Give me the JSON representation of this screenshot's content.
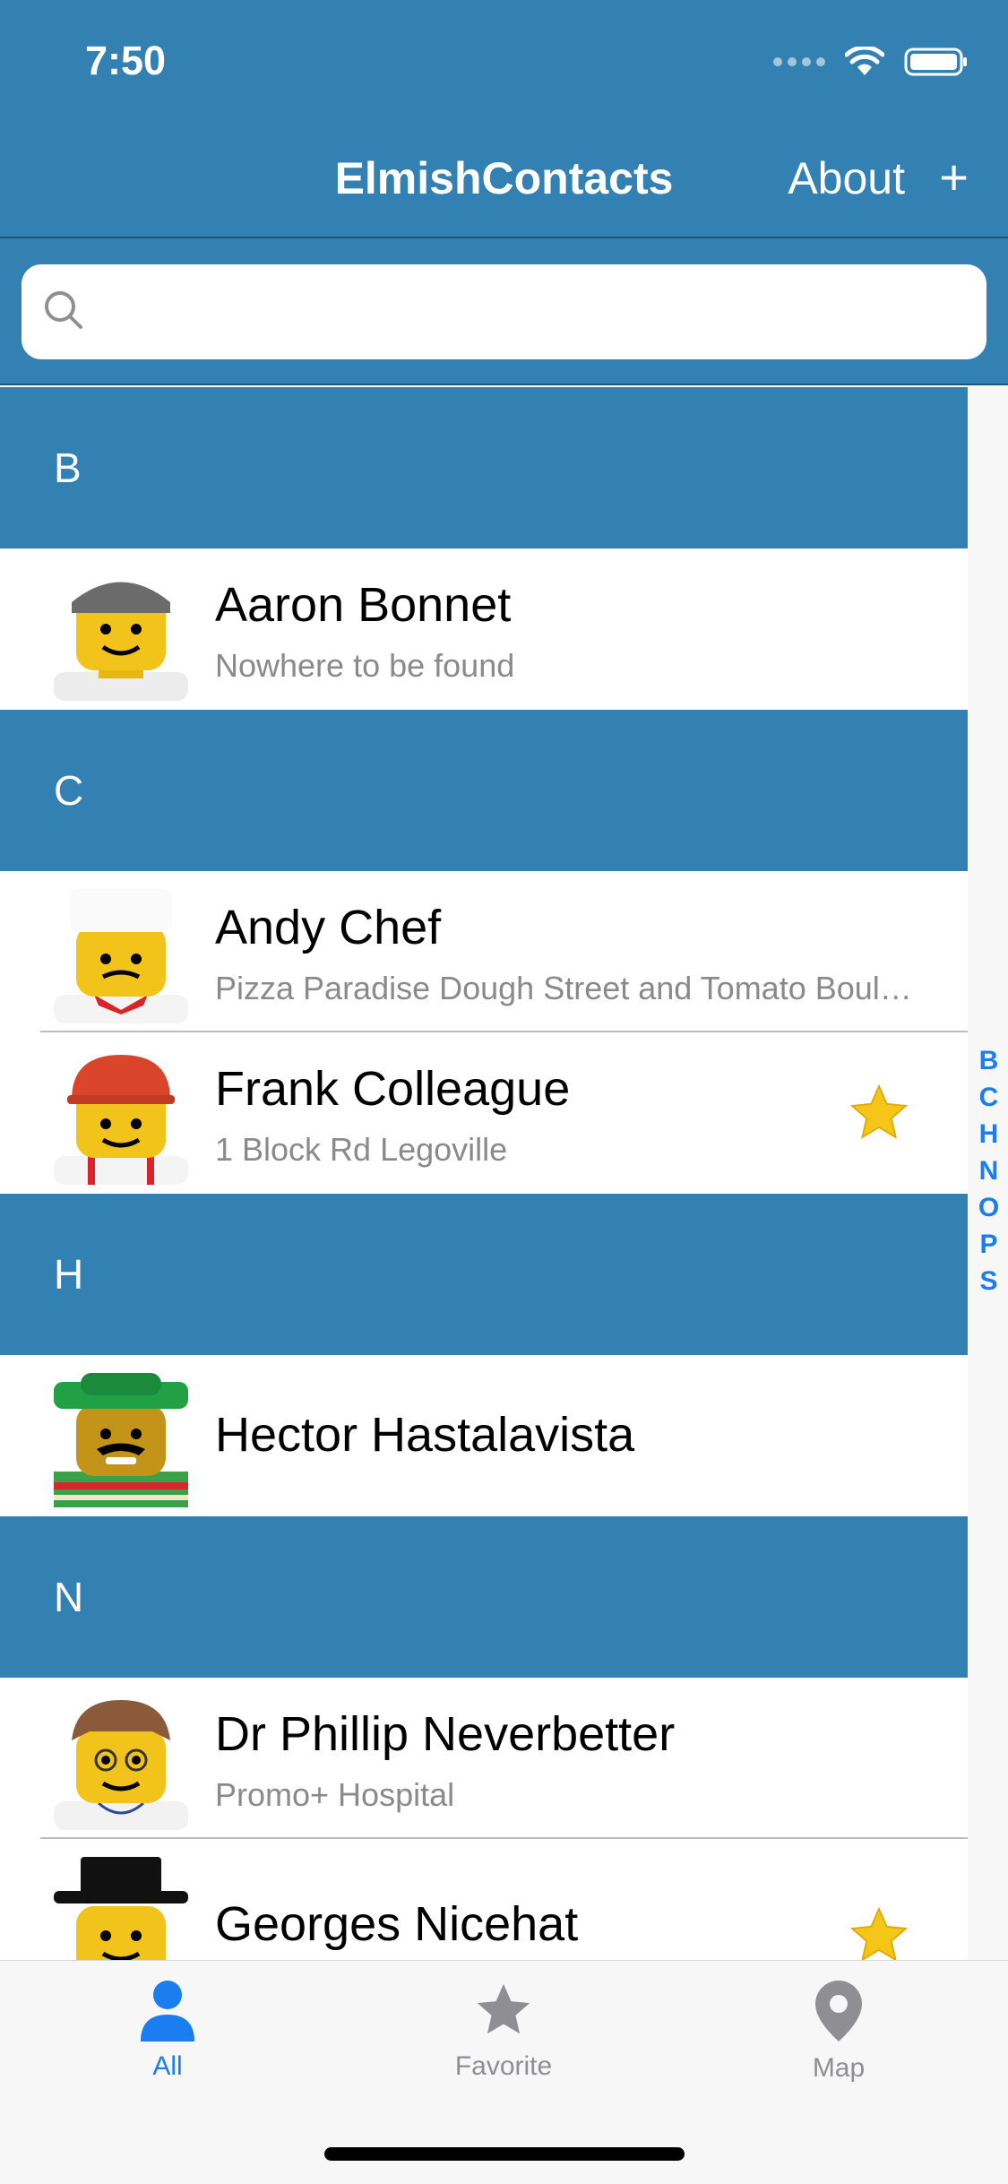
{
  "status_bar": {
    "time": "7:50"
  },
  "nav": {
    "title": "ElmishContacts",
    "about_label": "About",
    "add_label": "+"
  },
  "search": {
    "value": "",
    "placeholder": ""
  },
  "sections": [
    {
      "letter": "B",
      "contacts": [
        {
          "name": "Aaron Bonnet",
          "subtitle": "Nowhere to be found",
          "favorite": false,
          "avatar": "lego-beanie-avatar"
        }
      ]
    },
    {
      "letter": "C",
      "contacts": [
        {
          "name": "Andy Chef",
          "subtitle": "Pizza Paradise Dough Street and Tomato Boul…",
          "favorite": false,
          "avatar": "lego-chef-avatar"
        },
        {
          "name": "Frank Colleague",
          "subtitle": "1 Block Rd Legoville",
          "favorite": true,
          "avatar": "lego-hardhat-avatar"
        }
      ]
    },
    {
      "letter": "H",
      "contacts": [
        {
          "name": "Hector Hastalavista",
          "subtitle": "",
          "favorite": false,
          "avatar": "lego-sombrero-avatar"
        }
      ]
    },
    {
      "letter": "N",
      "contacts": [
        {
          "name": "Dr Phillip Neverbetter",
          "subtitle": "Promo+ Hospital",
          "favorite": false,
          "avatar": "lego-doctor-avatar"
        },
        {
          "name": "Georges Nicehat",
          "subtitle": "",
          "favorite": true,
          "avatar": "lego-tophat-avatar"
        }
      ]
    }
  ],
  "index_letters": [
    "B",
    "C",
    "H",
    "N",
    "O",
    "P",
    "S"
  ],
  "tabs": [
    {
      "label": "All",
      "icon": "person-icon",
      "active": true
    },
    {
      "label": "Favorite",
      "icon": "star-icon",
      "active": false
    },
    {
      "label": "Map",
      "icon": "map-pin-icon",
      "active": false
    }
  ],
  "colors": {
    "primary": "#3380b3",
    "accent": "#1a7df0",
    "inactive": "#8e8e93",
    "star": "#f5c518"
  }
}
